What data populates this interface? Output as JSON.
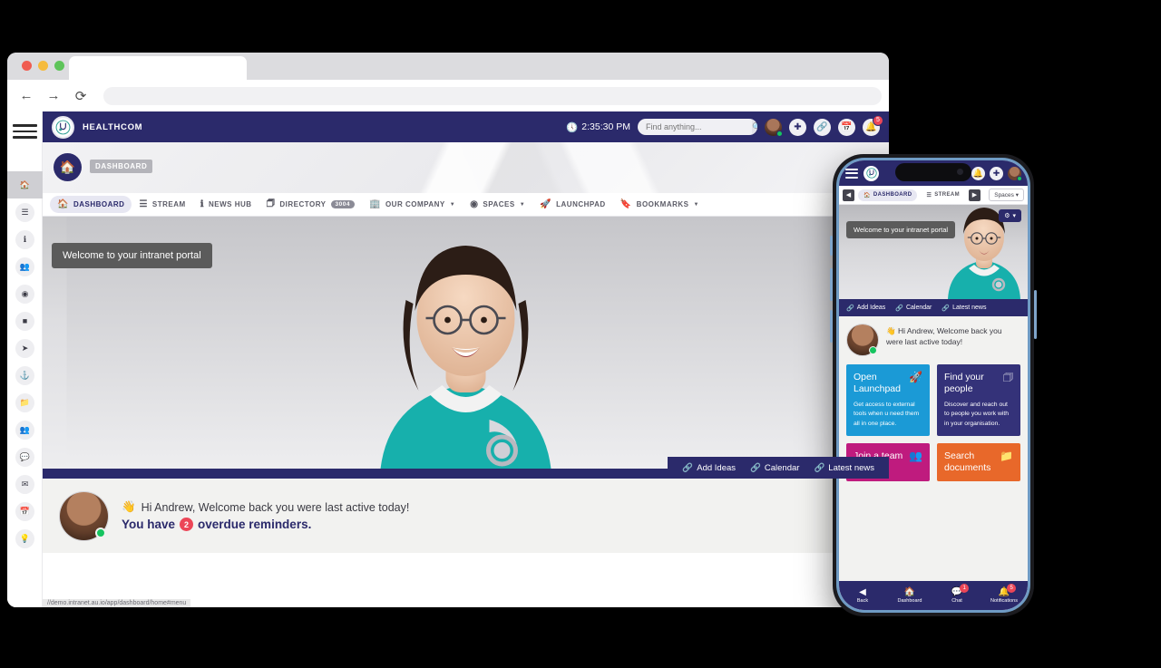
{
  "browser": {
    "back_icon": "back-arrow-icon",
    "forward_icon": "forward-arrow-icon",
    "reload_icon": "reload-icon",
    "tab_title": "",
    "address_value": ""
  },
  "app": {
    "brand_name": "HEALTHCOM",
    "clock": "2:35:30 PM",
    "search_placeholder": "Find anything...",
    "notification_count": "5",
    "breadcrumb": "DASHBOARD",
    "status_url": "//demo.intranet.au.io/app/dashboard/home#menu"
  },
  "rail": {
    "items": [
      {
        "name": "home",
        "icon": "🏠"
      },
      {
        "name": "stream",
        "icon": "☰"
      },
      {
        "name": "news-hub",
        "icon": "ℹ"
      },
      {
        "name": "directory",
        "icon": "👥"
      },
      {
        "name": "spaces",
        "icon": "◉"
      },
      {
        "name": "company",
        "icon": "■"
      },
      {
        "name": "launchpad",
        "icon": "➤"
      },
      {
        "name": "pinned",
        "icon": "⚓"
      },
      {
        "name": "files",
        "icon": "📁"
      },
      {
        "name": "people",
        "icon": "👥"
      },
      {
        "name": "chat",
        "icon": "💬"
      },
      {
        "name": "mail",
        "icon": "✉"
      },
      {
        "name": "calendar",
        "icon": "📅"
      },
      {
        "name": "ideas",
        "icon": "💡"
      }
    ]
  },
  "tabs": [
    {
      "label": "DASHBOARD",
      "icon": "🏠",
      "active": true,
      "badge": "",
      "caret": false
    },
    {
      "label": "STREAM",
      "icon": "☰",
      "active": false,
      "badge": "",
      "caret": false
    },
    {
      "label": "NEWS HUB",
      "icon": "ℹ",
      "active": false,
      "badge": "",
      "caret": false
    },
    {
      "label": "DIRECTORY",
      "icon": "📇",
      "active": false,
      "badge": "3004",
      "caret": false
    },
    {
      "label": "OUR COMPANY",
      "icon": "🏢",
      "active": false,
      "badge": "",
      "caret": true
    },
    {
      "label": "SPACES",
      "icon": "◉",
      "active": false,
      "badge": "",
      "caret": true
    },
    {
      "label": "LAUNCHPAD",
      "icon": "🚀",
      "active": false,
      "badge": "",
      "caret": false
    },
    {
      "label": "BOOKMARKS",
      "icon": "🔖",
      "active": false,
      "badge": "",
      "caret": true
    }
  ],
  "hero": {
    "tooltip": "Welcome to your intranet portal",
    "links": [
      {
        "label": "Add Ideas",
        "icon": "🔗"
      },
      {
        "label": "Calendar",
        "icon": "🔗"
      },
      {
        "label": "Latest news",
        "icon": "🔗"
      }
    ]
  },
  "welcome": {
    "wave": "👋",
    "line1": "Hi Andrew, Welcome back you were last active today!",
    "reminder_prefix": "You have",
    "reminder_count": "2",
    "reminder_suffix": "overdue reminders."
  },
  "phone": {
    "tabs": [
      {
        "label": "DASHBOARD",
        "icon": "🏠",
        "active": true
      },
      {
        "label": "STREAM",
        "icon": "☰",
        "active": false
      }
    ],
    "spaces_label": "Spaces",
    "gear_label": "⚙",
    "tooltip": "Welcome to your intranet portal",
    "links": [
      {
        "label": "Add Ideas",
        "icon": "🔗"
      },
      {
        "label": "Calendar",
        "icon": "🔗"
      },
      {
        "label": "Latest news",
        "icon": "🔗"
      }
    ],
    "welcome_text": "👋  Hi Andrew, Welcome back you were last active today!",
    "cards": [
      {
        "title": "Open Launchpad",
        "desc": "Get access to external tools when u need them all in one place.",
        "icon": "🚀",
        "color": "#1b9ad6"
      },
      {
        "title": "Find your people",
        "desc": "Discover and reach out to people you work with in your organisation.",
        "icon": "📕",
        "color": "#343279"
      },
      {
        "title": "Join a team",
        "desc": "",
        "icon": "👥",
        "color": "#bf1b7e"
      },
      {
        "title": "Search documents",
        "desc": "",
        "icon": "📁",
        "color": "#e8682a"
      }
    ],
    "bottom_nav": [
      {
        "label": "Back",
        "icon": "◀",
        "badge": ""
      },
      {
        "label": "Dashboard",
        "icon": "🏠",
        "badge": ""
      },
      {
        "label": "Chat",
        "icon": "💬",
        "badge": "1"
      },
      {
        "label": "Notifications",
        "icon": "🔔",
        "badge": "5"
      }
    ]
  },
  "colors": {
    "brand_navy": "#2b2a6b",
    "badge_red": "#ec4657",
    "online_green": "#16c45f"
  }
}
